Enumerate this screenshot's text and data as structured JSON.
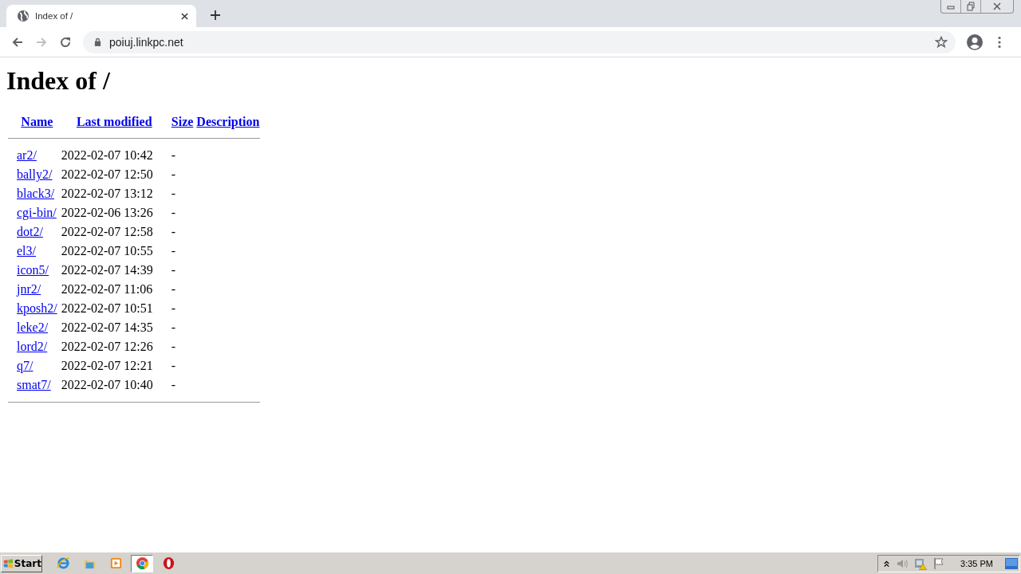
{
  "browser": {
    "tab": {
      "title": "Index of /"
    },
    "address": "poiuj.linkpc.net"
  },
  "page": {
    "heading": "Index of /",
    "columns": [
      "Name",
      "Last modified",
      "Size",
      "Description"
    ],
    "rows": [
      {
        "name": "ar2/",
        "modified": "2022-02-07 10:42",
        "size": "-"
      },
      {
        "name": "bally2/",
        "modified": "2022-02-07 12:50",
        "size": "-"
      },
      {
        "name": "black3/",
        "modified": "2022-02-07 13:12",
        "size": "-"
      },
      {
        "name": "cgi-bin/",
        "modified": "2022-02-06 13:26",
        "size": "-"
      },
      {
        "name": "dot2/",
        "modified": "2022-02-07 12:58",
        "size": "-"
      },
      {
        "name": "el3/",
        "modified": "2022-02-07 10:55",
        "size": "-"
      },
      {
        "name": "icon5/",
        "modified": "2022-02-07 14:39",
        "size": "-"
      },
      {
        "name": "jnr2/",
        "modified": "2022-02-07 11:06",
        "size": "-"
      },
      {
        "name": "kposh2/",
        "modified": "2022-02-07 10:51",
        "size": "-"
      },
      {
        "name": "leke2/",
        "modified": "2022-02-07 14:35",
        "size": "-"
      },
      {
        "name": "lord2/",
        "modified": "2022-02-07 12:26",
        "size": "-"
      },
      {
        "name": "q7/",
        "modified": "2022-02-07 12:21",
        "size": "-"
      },
      {
        "name": "smat7/",
        "modified": "2022-02-07 10:40",
        "size": "-"
      }
    ]
  },
  "taskbar": {
    "start": "Start",
    "apps": [
      {
        "kind": "ie",
        "selected": false
      },
      {
        "kind": "folder",
        "selected": false
      },
      {
        "kind": "media",
        "selected": false
      },
      {
        "kind": "chrome",
        "selected": true
      },
      {
        "kind": "opera",
        "selected": false
      }
    ],
    "clock": "3:35 PM"
  }
}
